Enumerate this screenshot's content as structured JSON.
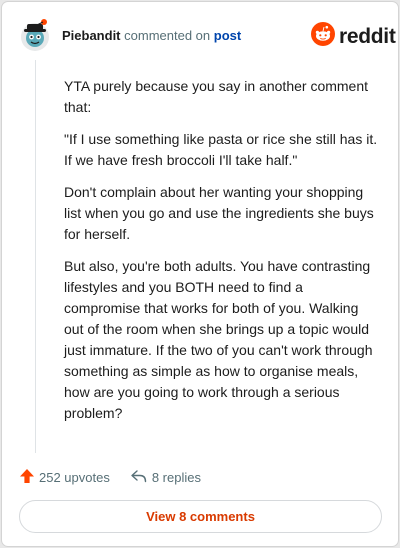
{
  "header": {
    "username": "Piebandit",
    "commented_on": "commented on",
    "post_link": "post",
    "brand": "reddit"
  },
  "comment": {
    "paragraphs": [
      "YTA purely because you say in another comment that:",
      "\"If I use something like pasta or rice she still has it. If we have fresh broccoli I'll take half.\"",
      "Don't complain about her wanting your shopping list when you go and use the ingredients she buys for herself.",
      "But also, you're both adults. You have contrasting lifestyles and you BOTH need to find a compromise that works for both of you. Walking out of the room when she brings up a topic would just immature. If the two of you can't work through something as simple as how to organise meals, how are you going to work through a serious problem?"
    ]
  },
  "actions": {
    "upvotes": "252 upvotes",
    "replies": "8 replies"
  },
  "footer": {
    "view_comments": "View 8 comments"
  },
  "colors": {
    "brand_orange": "#ff4500",
    "link_blue": "#0045ac",
    "button_text": "#d93a00"
  },
  "icons": {
    "avatar": "snoo-avatar-icon",
    "logo": "reddit-logo-icon",
    "upvote": "upvote-arrow-icon",
    "reply": "reply-arrow-icon"
  }
}
